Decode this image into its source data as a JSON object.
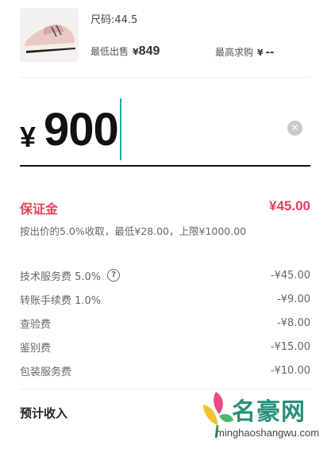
{
  "product": {
    "size_text": "尺码:44.5",
    "lowest_label": "最低出售",
    "lowest_currency": "¥",
    "lowest_value": "849",
    "highest_label": "最高求购",
    "highest_currency": "¥",
    "highest_value": "--"
  },
  "price_input": {
    "currency": "¥",
    "value": "900"
  },
  "deposit": {
    "label": "保证金",
    "amount": "¥45.00",
    "note": "按出价的5.0%收取，最低¥28.00，上限¥1000.00"
  },
  "fees": [
    {
      "label": "技术服务费 5.0%",
      "amount": "-¥45.00",
      "help": "?"
    },
    {
      "label": "转账手续费 1.0%",
      "amount": "-¥9.00"
    },
    {
      "label": "查验费",
      "amount": "-¥8.00"
    },
    {
      "label": "鉴别费",
      "amount": "-¥15.00"
    },
    {
      "label": "包装服务费",
      "amount": "-¥10.00"
    }
  ],
  "income": {
    "label": "预计收入"
  },
  "watermark": {
    "brand": "名豪网",
    "url": "minghaoshangwu.com"
  },
  "colors": {
    "accent_red": "#e8405a",
    "caret": "#1aa9a9"
  }
}
